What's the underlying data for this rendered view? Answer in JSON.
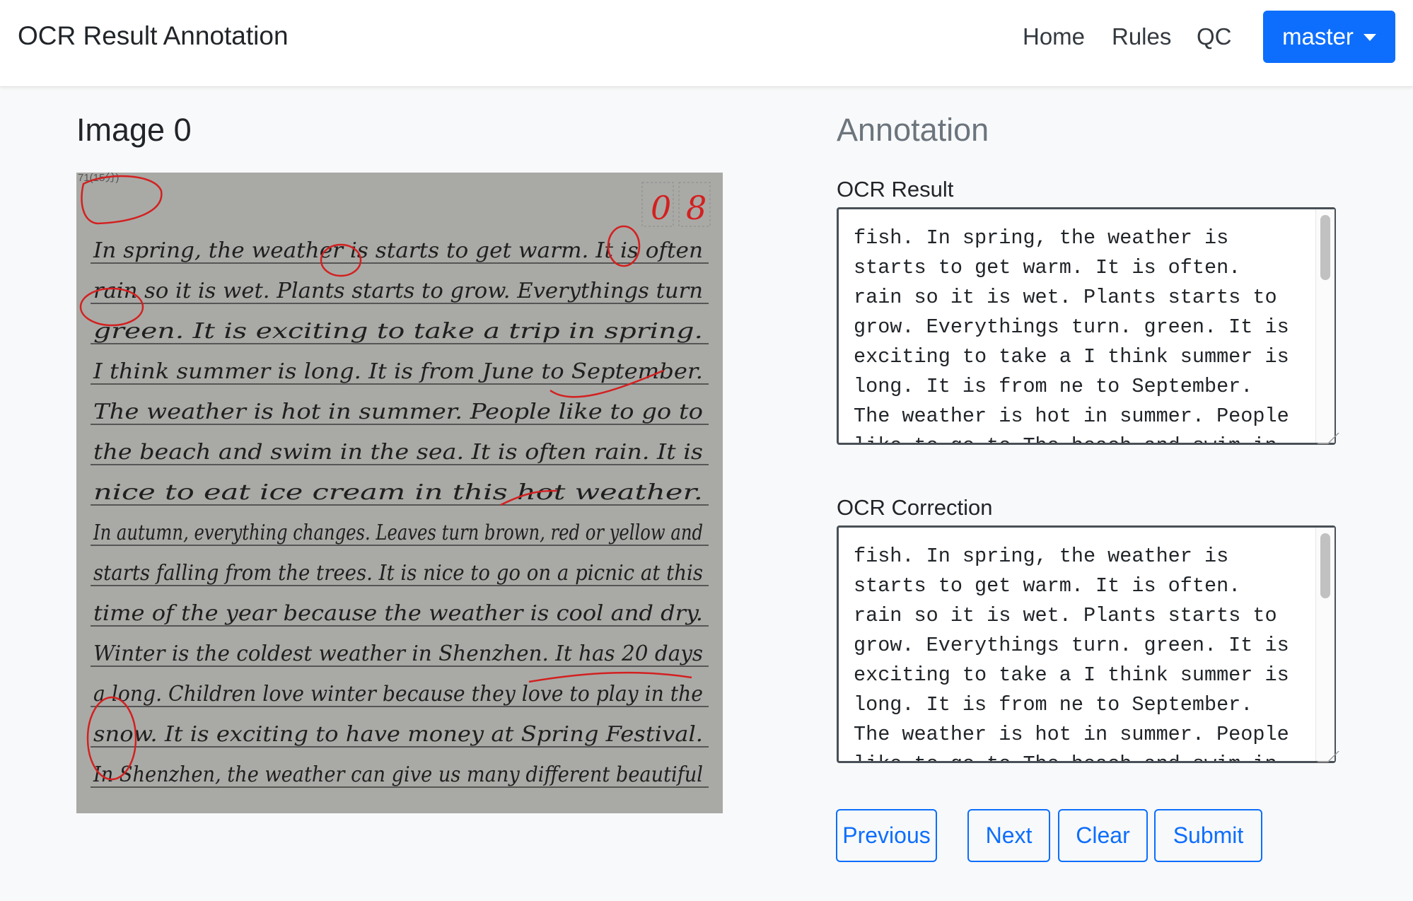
{
  "navbar": {
    "brand": "OCR Result Annotation",
    "links": [
      "Home",
      "Rules",
      "QC"
    ],
    "user_menu_label": "master",
    "accent_color": "#0d6efd"
  },
  "image_panel": {
    "title": "Image 0",
    "handwriting_lines": [
      "In spring, the weather is starts to get warm. It is often",
      "rain so it is wet. Plants starts to grow. Everythings turn",
      "green. It is exciting to take a trip in spring.",
      "I think summer is long. It is from June to September.",
      "The weather is hot in summer. People like to go to",
      "the beach and swim in the sea. It is often rain. It is",
      "nice to eat ice cream in this hot weather.",
      "In autumn, everything changes. Leaves turn brown, red or yellow and",
      "starts falling from the trees. It is nice to go on a picnic at this",
      "time of the year because the weather is cool and dry.",
      "Winter is the coldest weather in Shenzhen. It has 20 days",
      "a long. Children love winter because they love to play in the",
      "snow. It is exciting to have money at Spring Festival.",
      "In Shenzhen, the weather can give us many different beautiful"
    ],
    "score_marks": [
      "0",
      "8"
    ],
    "margin_note": "71(15分)"
  },
  "annotation_panel": {
    "title": "Annotation",
    "ocr_result_label": "OCR Result",
    "ocr_result_text": "fish. In spring, the weather is starts to get warm. It is often. rain so it is wet. Plants starts to grow. Everythings turn. green. It is exciting to take a I think summer is long. It is from ne to September. The weather is hot in summer. People like to go to The beach and swim in the",
    "ocr_correction_label": "OCR Correction",
    "ocr_correction_text": "fish. In spring, the weather is starts to get warm. It is often. rain so it is wet. Plants starts to grow. Everythings turn. green. It is exciting to take a I think summer is long. It is from ne to September. The weather is hot in summer. People like to go to The beach and swim in the"
  },
  "buttons": {
    "previous": "Previous",
    "next": "Next",
    "clear": "Clear",
    "submit": "Submit"
  }
}
